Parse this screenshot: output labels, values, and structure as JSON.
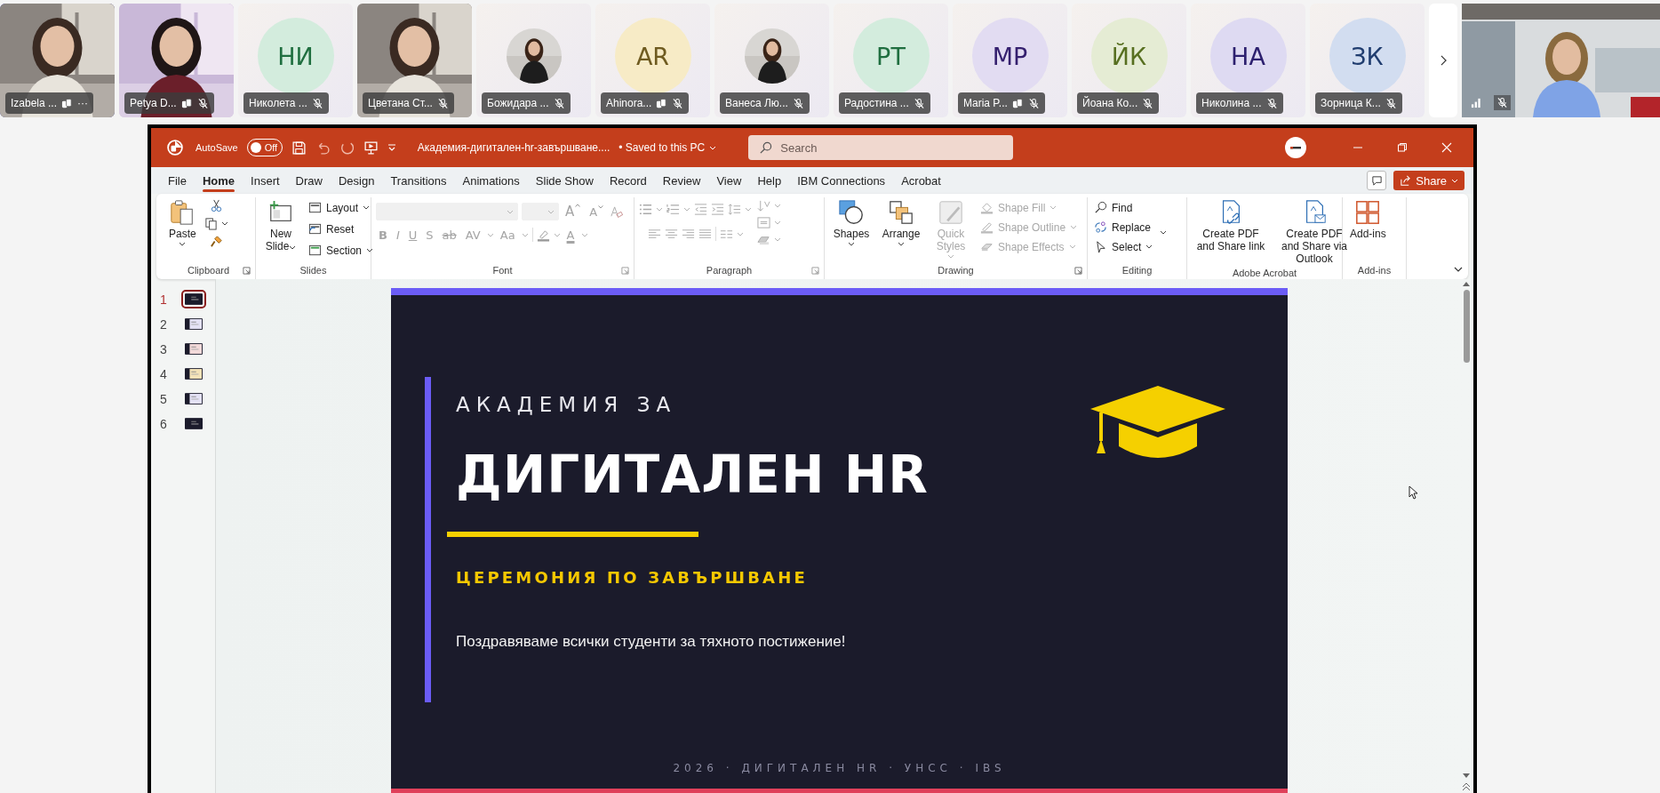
{
  "meeting": {
    "participants": [
      {
        "name": "Izabela ...",
        "kind": "video",
        "speaking": true,
        "muted": false,
        "device": true,
        "menu": "···"
      },
      {
        "name": "Petya D...",
        "kind": "video",
        "speaking": false,
        "muted": true,
        "device": true
      },
      {
        "name": "Николета ...",
        "kind": "initials",
        "initials": "НИ",
        "color": "#d3ecdd",
        "speaking": false,
        "muted": true,
        "device": false
      },
      {
        "name": "Цветана Ст...",
        "kind": "video",
        "speaking": false,
        "muted": true,
        "device": false
      },
      {
        "name": "Божидара ...",
        "speaking": false,
        "muted": true,
        "device": false
      },
      {
        "name": "Ahinora...",
        "kind": "initials",
        "initials": "AR",
        "color": "#f7ebc6",
        "speaking": false,
        "muted": true,
        "device": true
      },
      {
        "name": "Ванеса Лю...",
        "speaking": false,
        "muted": true,
        "device": false
      },
      {
        "name": "Радостина ...",
        "kind": "initials",
        "initials": "РТ",
        "color": "#d3ecdd",
        "speaking": false,
        "muted": true,
        "device": false
      },
      {
        "name": "Maria P...",
        "kind": "initials",
        "initials": "МР",
        "color": "#e2dcf2",
        "speaking": false,
        "muted": true,
        "device": true
      },
      {
        "name": "Йоана Ко...",
        "kind": "initials",
        "initials": "ЙК",
        "color": "#e5ecd4",
        "speaking": false,
        "muted": true,
        "device": false
      },
      {
        "name": "Николина ...",
        "kind": "initials",
        "initials": "НА",
        "color": "#dedaf2",
        "speaking": false,
        "muted": true,
        "device": false
      },
      {
        "name": "Зорница К...",
        "kind": "initials",
        "initials": "ЗК",
        "color": "#d2ddf0",
        "speaking": false,
        "muted": true,
        "device": false
      }
    ],
    "self_view": {
      "kind": "video",
      "muted": true
    }
  },
  "window": {
    "autosave": {
      "label": "AutoSave",
      "on": false,
      "state": "Off"
    },
    "filename": "Академия-дигитален-hr-завършване....",
    "saved": "• Saved to this PC",
    "search": {
      "placeholder": "Search"
    }
  },
  "tabs": [
    {
      "label": "File",
      "selected": false
    },
    {
      "label": "Home",
      "selected": true
    },
    {
      "label": "Insert",
      "selected": false
    },
    {
      "label": "Draw",
      "selected": false
    },
    {
      "label": "Design",
      "selected": false
    },
    {
      "label": "Transitions",
      "selected": false
    },
    {
      "label": "Animations",
      "selected": false
    },
    {
      "label": "Slide Show",
      "selected": false
    },
    {
      "label": "Record",
      "selected": false
    },
    {
      "label": "Review",
      "selected": false
    },
    {
      "label": "View",
      "selected": false
    },
    {
      "label": "Help",
      "selected": false
    },
    {
      "label": "IBM Connections",
      "selected": false
    },
    {
      "label": "Acrobat",
      "selected": false
    }
  ],
  "share": "Share",
  "ribbon": {
    "groups": [
      {
        "label": "Clipboard",
        "items": [
          {
            "label": "Paste"
          }
        ]
      },
      {
        "label": "Slides",
        "items": [
          {
            "label": "New Slide"
          },
          {
            "label": "Layout"
          },
          {
            "label": "Reset"
          },
          {
            "label": "Section"
          }
        ]
      },
      {
        "label": "Font",
        "disabled": true,
        "glyphs": [
          "B",
          "I",
          "U",
          "S",
          "ab",
          "AV",
          "Aa",
          "A"
        ],
        "size_glyphs": [
          "A",
          "A"
        ]
      },
      {
        "label": "Paragraph",
        "disabled": true
      },
      {
        "label": "Drawing",
        "items": [
          {
            "label": "Shapes",
            "disabled": false
          },
          {
            "label": "Arrange",
            "disabled": false
          },
          {
            "label": "Quick Styles",
            "disabled": true
          },
          {
            "label": "Shape Fill",
            "disabled": true
          },
          {
            "label": "Shape Outline",
            "disabled": true
          },
          {
            "label": "Shape Effects",
            "disabled": true
          }
        ]
      },
      {
        "label": "Editing",
        "items": [
          {
            "label": "Find"
          },
          {
            "label": "Replace"
          },
          {
            "label": "Select"
          }
        ]
      },
      {
        "label": "Adobe Acrobat",
        "items": [
          {
            "label": "Create PDF and Share link"
          },
          {
            "label": "Create PDF and Share via Outlook"
          }
        ]
      },
      {
        "label": "Add-ins",
        "items": [
          {
            "label": "Add-ins"
          }
        ]
      }
    ]
  },
  "slides_pane": [
    {
      "number": "1",
      "selected": true,
      "color": "#1b1b2b"
    },
    {
      "number": "2",
      "selected": false,
      "color": "#e4e2f5"
    },
    {
      "number": "3",
      "selected": false,
      "color": "#f3dada"
    },
    {
      "number": "4",
      "selected": false,
      "color": "#f4e3b8"
    },
    {
      "number": "5",
      "selected": false,
      "color": "#e4e2f5"
    },
    {
      "number": "6",
      "selected": false,
      "color": "#1b1b2b"
    }
  ],
  "slide": {
    "kicker": "АКАДЕМИЯ ЗА",
    "title": "ДИГИТАЛЕН HR",
    "subtitle": "ЦЕРЕМОНИЯ ПО ЗАВЪРШВАНЕ",
    "body": "Поздравяваме всички студенти за тяхното постижение!",
    "footer": "2026 · ДИГИТАЛЕН HR · УНСС · IBS"
  }
}
